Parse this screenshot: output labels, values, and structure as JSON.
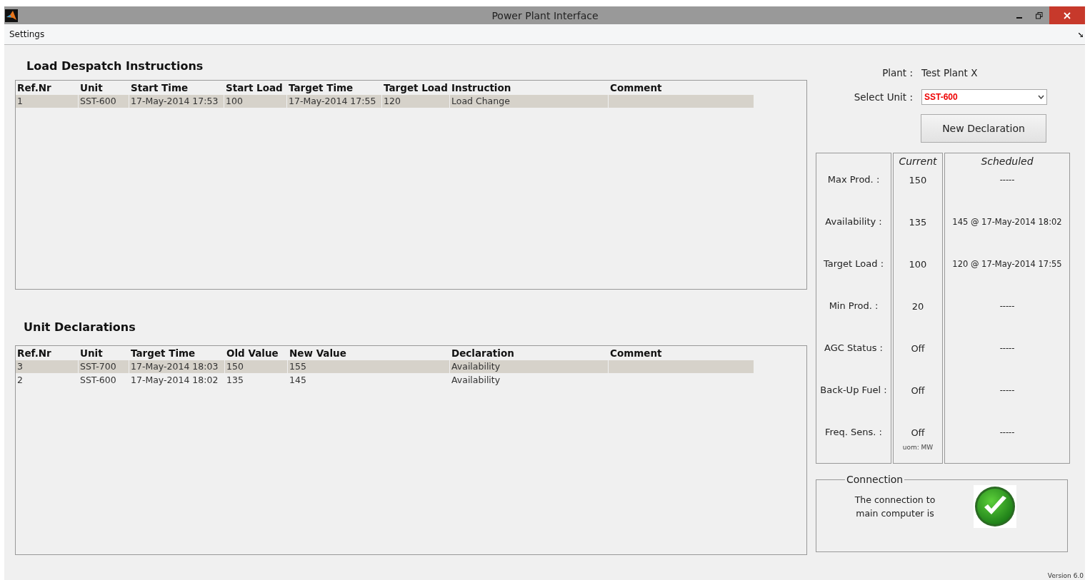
{
  "window": {
    "title": "Power Plant Interface"
  },
  "menu": [
    "Settings"
  ],
  "dispatch": {
    "title": "Load Despatch Instructions",
    "columns": [
      "Ref.Nr",
      "Unit",
      "Start Time",
      "Start Load",
      "Target Time",
      "Target Load",
      "Instruction",
      "Comment"
    ],
    "rows": [
      {
        "cells": [
          "1",
          "SST-600",
          "17-May-2014 17:53",
          "100",
          "17-May-2014 17:55",
          "120",
          "Load Change",
          ""
        ],
        "selected": true
      }
    ]
  },
  "declarations": {
    "title": "Unit Declarations",
    "columns": [
      "Ref.Nr",
      "Unit",
      "Target Time",
      "Old Value",
      "New Value",
      "Declaration",
      "Comment"
    ],
    "rows": [
      {
        "cells": [
          "3",
          "SST-700",
          "17-May-2014 18:03",
          "150",
          "155",
          "Availability",
          ""
        ],
        "selected": true
      },
      {
        "cells": [
          "2",
          "SST-600",
          "17-May-2014 18:02",
          "135",
          "145",
          "Availability",
          ""
        ],
        "selected": false
      }
    ]
  },
  "plant": {
    "label": "Plant :",
    "value": "Test Plant X"
  },
  "unit_select": {
    "label": "Select Unit :",
    "value": "SST-600"
  },
  "new_declaration_button": "New Declaration",
  "status": {
    "columns": [
      "Current",
      "Scheduled"
    ],
    "unit_note": "uom: MW",
    "rows": [
      {
        "label": "Max Prod. :",
        "current": "150",
        "scheduled": "-----"
      },
      {
        "label": "Availability :",
        "current": "135",
        "scheduled": "145 @ 17-May-2014 18:02"
      },
      {
        "label": "Target Load :",
        "current": "100",
        "scheduled": "120 @ 17-May-2014 17:55"
      },
      {
        "label": "Min Prod. :",
        "current": "20",
        "scheduled": "-----"
      },
      {
        "label": "AGC Status :",
        "current": "Off",
        "scheduled": "-----"
      },
      {
        "label": "Back-Up Fuel :",
        "current": "Off",
        "scheduled": "-----"
      },
      {
        "label": "Freq. Sens. :",
        "current": "Off",
        "scheduled": "-----"
      }
    ]
  },
  "connection": {
    "title": "Connection",
    "message": "The connection to main computer is",
    "connected": true
  },
  "version": "Version 6.0"
}
